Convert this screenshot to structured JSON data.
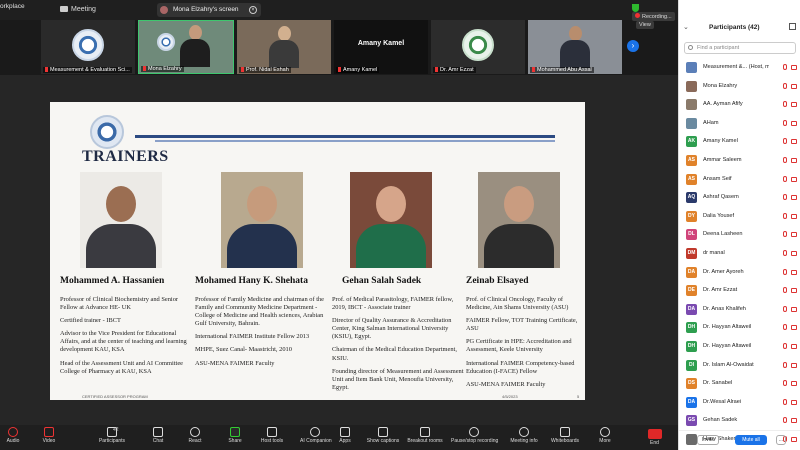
{
  "window": {
    "app_name": "orkplace",
    "meeting_label": "Meeting"
  },
  "share_pill": {
    "label": "Mona Elzahry's screen"
  },
  "status": {
    "recording": "Recording...",
    "view": "View"
  },
  "thumbnails": [
    {
      "name": "Measurement & Evaluation Sci..."
    },
    {
      "name": "Mona Elzahry"
    },
    {
      "name": "Prof. Nidal Eshah"
    },
    {
      "name": "Amany Kamel",
      "big": "Amany Kamel"
    },
    {
      "name": "Dr. Amr Ezzat"
    },
    {
      "name": "Mohammed Abu Assal"
    }
  ],
  "slide": {
    "title": "TRAINERS",
    "footer_left": "CERTIFIED ASSESSOR PROGRAM",
    "footer_date": "4/5/2023",
    "page_no": "5",
    "trainers": [
      {
        "name": "Mohammed A. Hassanien",
        "lines": [
          "Professor of Clinical Biochemistry and Senior Fellow at Advance HE- UK",
          "Certified trainer - IBCT",
          "Advisor to the Vice President for Educational Affairs, and at the center of teaching and learning development KAU, KSA",
          "Head of the Assessment Unit and AI Committee College of Pharmacy at KAU, KSA"
        ]
      },
      {
        "name": "Mohamed Hany K. Shehata",
        "lines": [
          "Professor of Family Medicine and chairman of the Family and Community Medicine Department - College of Medicine and Health sciences, Arabian Gulf University, Bahrain.",
          "International FAIMER Institute Fellow 2013",
          "MHPE, Suez Canal- Maastricht, 2010",
          "ASU-MENA FAIMER Faculty"
        ]
      },
      {
        "name": "Gehan Salah Sadek",
        "lines": [
          "Prof. of Medical Parasitology, FAIMER fellow, 2019, IBCT - Associate trainer",
          "Director of Quality Assurance & Accreditation Center, King Salman International University (KSIU), Egypt.",
          "Chairman of the Medical Education Department, KSIU.",
          "Founding director of Measurement and Assessment Unit and Item Bank Unit, Menoufia University, Egypt."
        ]
      },
      {
        "name": "Zeinab Elsayed",
        "lines": [
          "Prof. of Clinical Oncology, Faculty of Medicine, Ain Shams University (ASU)",
          "FAIMER Fellow, TOT Training Certificate, ASU",
          "PG Certificate in HPE: Accreditation and Assessment, Keele University",
          "International FAIMER Competency-based Education (I-FACE) Fellow",
          "ASU-MENA FAIMER Faculty"
        ]
      }
    ]
  },
  "participants": {
    "title": "Participants (42)",
    "search_placeholder": "Find a participant",
    "invite": "Invite",
    "mute_all": "Mute all",
    "more": "...",
    "list": [
      {
        "initials": "",
        "name": "Measurement &... (Host, me)",
        "color": "#5b7fb8"
      },
      {
        "initials": "",
        "name": "Mona Elzahry",
        "color": "#8a6a5a"
      },
      {
        "initials": "",
        "name": "AA. Ayman Afify",
        "color": "#8a7a6a"
      },
      {
        "initials": "",
        "name": "AHam",
        "color": "#6a8aa0"
      },
      {
        "initials": "AK",
        "name": "Amany Kamel",
        "color": "#2e9e4f"
      },
      {
        "initials": "AS",
        "name": "Ammar Saleem",
        "color": "#e0822a"
      },
      {
        "initials": "AS",
        "name": "Ansam Seif",
        "color": "#e0822a"
      },
      {
        "initials": "AQ",
        "name": "Ashraf Qasem",
        "color": "#2b3a6b"
      },
      {
        "initials": "DY",
        "name": "Dalia Yousef",
        "color": "#e0822a"
      },
      {
        "initials": "DL",
        "name": "Deena Lasheen",
        "color": "#d0447a"
      },
      {
        "initials": "DM",
        "name": "dr manal",
        "color": "#c0392b"
      },
      {
        "initials": "DA",
        "name": "Dr. Amer Ayoreh",
        "color": "#e0822a"
      },
      {
        "initials": "DE",
        "name": "Dr. Amr Ezzat",
        "color": "#e0822a"
      },
      {
        "initials": "DA",
        "name": "Dr. Anas Khalifeh",
        "color": "#7a4ab0"
      },
      {
        "initials": "DH",
        "name": "Dr. Hayyan Altaweil",
        "color": "#2e9e4f"
      },
      {
        "initials": "DH",
        "name": "Dr. Hayyan Altaweil",
        "color": "#2e9e4f"
      },
      {
        "initials": "DI",
        "name": "Dr. Islam Al-Owaidat",
        "color": "#2e9e4f"
      },
      {
        "initials": "DS",
        "name": "Dr. Sanabel",
        "color": "#e0822a"
      },
      {
        "initials": "DA",
        "name": "Dr.Wesal Alraei",
        "color": "#1a73e8"
      },
      {
        "initials": "GS",
        "name": "Gehan Sadek",
        "color": "#7a4ab0"
      },
      {
        "initials": "",
        "name": "Hany Shaker",
        "color": "#6a6a6a"
      }
    ]
  },
  "toolbar": {
    "audio": "Audio",
    "video": "Video",
    "participants": "Participants",
    "participants_count": "42",
    "chat": "Chat",
    "react": "React",
    "share": "Share",
    "host_tools": "Host tools",
    "ai_companion": "AI Companion",
    "apps": "Apps",
    "show_captions": "Show captions",
    "breakout_rooms": "Breakout rooms",
    "pause_recording": "Pause/stop recording",
    "meeting_info": "Meeting info",
    "whiteboards": "Whiteboards",
    "more": "More",
    "end": "End"
  }
}
